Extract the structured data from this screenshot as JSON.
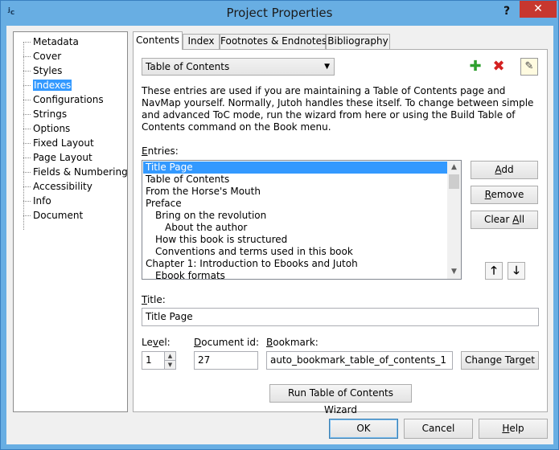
{
  "window": {
    "title": "Project Properties",
    "app_icon": "jutoh-icon",
    "help_glyph": "?",
    "close_glyph": "✕"
  },
  "sidebar": {
    "items": [
      {
        "label": "Metadata"
      },
      {
        "label": "Cover"
      },
      {
        "label": "Styles"
      },
      {
        "label": "Indexes",
        "selected": true
      },
      {
        "label": "Configurations"
      },
      {
        "label": "Strings"
      },
      {
        "label": "Options"
      },
      {
        "label": "Fixed Layout"
      },
      {
        "label": "Page Layout"
      },
      {
        "label": "Fields & Numbering"
      },
      {
        "label": "Accessibility"
      },
      {
        "label": "Info"
      },
      {
        "label": "Document"
      }
    ]
  },
  "tabs": [
    {
      "label": "Contents",
      "active": true
    },
    {
      "label": "Index"
    },
    {
      "label": "Footnotes & Endnotes"
    },
    {
      "label": "Bibliography"
    }
  ],
  "contents": {
    "type_select": {
      "value": "Table of Contents"
    },
    "icons": {
      "add": "add-icon",
      "delete": "delete-icon",
      "edit": "edit-icon"
    },
    "description": "These entries are used if you are maintaining a Table of Contents page and NavMap yourself. Normally, Jutoh handles these itself. To change between simple and advanced ToC mode, run the wizard from here or using the Build Table of Contents command on the Book menu.",
    "entries_label": {
      "accel": "E",
      "rest": "ntries:"
    },
    "entries": [
      {
        "label": "Title Page",
        "indent": 0,
        "selected": true
      },
      {
        "label": "Table of Contents",
        "indent": 0
      },
      {
        "label": "From the Horse's Mouth",
        "indent": 0
      },
      {
        "label": "Preface",
        "indent": 0
      },
      {
        "label": "Bring on the revolution",
        "indent": 1
      },
      {
        "label": "About the author",
        "indent": 2
      },
      {
        "label": "How this book is structured",
        "indent": 1
      },
      {
        "label": "Conventions and terms used in this book",
        "indent": 1
      },
      {
        "label": "Chapter 1: Introduction to Ebooks and Jutoh",
        "indent": 0
      },
      {
        "label": "Ebook formats",
        "indent": 1
      }
    ],
    "buttons": {
      "add": {
        "accel": "A",
        "rest": "dd"
      },
      "remove": {
        "accel": "R",
        "rest": "emove"
      },
      "clear_all": {
        "pre": "Clear ",
        "accel": "A",
        "rest": "ll"
      },
      "move_up_glyph": "🡑",
      "move_down_glyph": "🡓"
    },
    "title_label": {
      "accel": "T",
      "rest": "itle:"
    },
    "title_value": "Title Page",
    "level_label": {
      "pre": "Le",
      "accel": "v",
      "rest": "el:"
    },
    "level_value": "1",
    "docid_label": {
      "accel": "D",
      "rest": "ocument id:"
    },
    "docid_value": "27",
    "bookmark_label": {
      "accel": "B",
      "rest": "ookmark:"
    },
    "bookmark_value": "auto_bookmark_table_of_contents_1",
    "change_target": {
      "pre": "Change Tar",
      "accel": "g",
      "rest": "et"
    },
    "wizard_button": "Run Table of Contents Wizard"
  },
  "footer": {
    "ok": "OK",
    "cancel": "Cancel",
    "help": {
      "accel": "H",
      "rest": "elp"
    }
  }
}
